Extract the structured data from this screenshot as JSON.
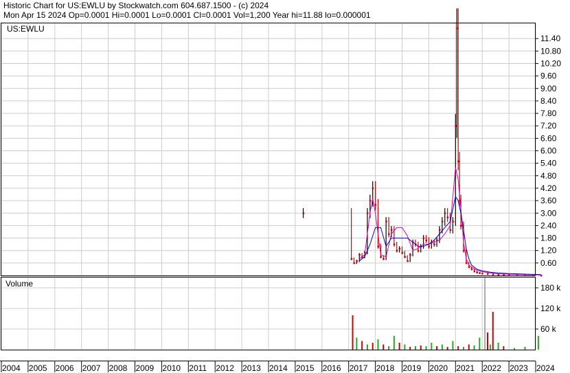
{
  "header": {
    "line1": "Historic Chart for US:EWLU by Stockwatch.com 604.687.1500 - (c) 2024",
    "line2": "Mon Apr 15 2024   Op=0.0001   Hi=0.0001   Lo=0.0001   Cl=0.0001   Vol=1,200   Year hi=11.88   lo=0.000001"
  },
  "colors": {
    "price": "#000000",
    "down": "#cc0000",
    "ma_short": "#dd00aa",
    "ma_long": "#0000cc",
    "vol_up": "#22aa22",
    "vol_down": "#cc0000",
    "vol_big": "#aaaaaa",
    "grid": "#cccccc"
  },
  "chart_data": [
    {
      "type": "line",
      "title": "US:EWLU",
      "x_labels": [
        "2004",
        "2005",
        "2006",
        "2007",
        "2008",
        "2009",
        "2010",
        "2011",
        "2012",
        "2013",
        "2014",
        "2015",
        "2016",
        "2017",
        "2018",
        "2019",
        "2020",
        "2021",
        "2022",
        "2023",
        "2024"
      ],
      "ylim": [
        0,
        12.0
      ],
      "y_ticks": [
        "0.60",
        "1.20",
        "1.80",
        "2.40",
        "3.00",
        "3.60",
        "4.20",
        "4.80",
        "5.40",
        "6.00",
        "6.60",
        "7.20",
        "7.80",
        "8.40",
        "9.00",
        "9.60",
        "10.20",
        "10.80",
        "11.40"
      ],
      "grid": true,
      "series": [
        {
          "role": "price",
          "x": [
            2015.3,
            2017.1,
            2017.2,
            2017.3,
            2017.4,
            2017.5,
            2017.6,
            2017.7,
            2017.8,
            2017.9,
            2018.0,
            2018.1,
            2018.2,
            2018.3,
            2018.4,
            2018.5,
            2018.6,
            2018.7,
            2018.8,
            2018.9,
            2019.0,
            2019.1,
            2019.2,
            2019.3,
            2019.4,
            2019.5,
            2019.6,
            2019.7,
            2019.8,
            2019.9,
            2020.0,
            2020.1,
            2020.2,
            2020.3,
            2020.4,
            2020.5,
            2020.6,
            2020.7,
            2020.8,
            2020.9,
            2021.0,
            2021.05,
            2021.1,
            2021.15,
            2021.2,
            2021.3,
            2021.4,
            2021.5,
            2021.6,
            2021.7,
            2021.8,
            2021.9,
            2022.0,
            2022.2,
            2022.4,
            2022.6,
            2022.8,
            2023.0,
            2023.3,
            2023.6,
            2023.9,
            2024.2
          ],
          "values": [
            3.0,
            0.8,
            0.6,
            0.7,
            1.0,
            0.9,
            1.1,
            3.0,
            3.6,
            4.2,
            3.4,
            1.4,
            0.9,
            0.8,
            2.6,
            2.0,
            2.2,
            1.5,
            1.2,
            1.3,
            1.1,
            0.9,
            0.7,
            1.0,
            1.6,
            1.5,
            1.2,
            1.4,
            1.8,
            1.7,
            1.4,
            1.6,
            1.5,
            1.7,
            2.2,
            2.6,
            3.0,
            2.8,
            2.2,
            2.6,
            7.2,
            11.9,
            5.5,
            3.6,
            2.4,
            1.2,
            0.6,
            0.4,
            0.3,
            0.2,
            0.15,
            0.12,
            0.1,
            0.08,
            0.06,
            0.05,
            0.04,
            0.03,
            0.02,
            0.01,
            0.005,
            0.0001
          ]
        },
        {
          "role": "ma_short",
          "x": [
            2017.4,
            2017.6,
            2017.7,
            2017.8,
            2017.9,
            2018.0,
            2018.2,
            2018.4,
            2018.6,
            2018.8,
            2019.0,
            2019.2,
            2019.4,
            2019.6,
            2019.8,
            2020.0,
            2020.2,
            2020.4,
            2020.6,
            2020.8,
            2021.0,
            2021.1,
            2021.2,
            2021.3,
            2021.4,
            2021.5,
            2021.6,
            2021.8,
            2022.0,
            2022.3,
            2022.6,
            2023.0,
            2023.5,
            2024.0,
            2024.2
          ],
          "values": [
            0.8,
            1.0,
            2.0,
            3.0,
            3.7,
            3.0,
            1.0,
            0.9,
            2.0,
            2.3,
            2.3,
            1.9,
            1.2,
            1.3,
            1.5,
            1.5,
            1.6,
            1.7,
            2.0,
            2.4,
            5.2,
            4.6,
            3.2,
            1.6,
            0.8,
            0.5,
            0.4,
            0.25,
            0.18,
            0.12,
            0.08,
            0.06,
            0.04,
            0.03,
            0.02
          ]
        },
        {
          "role": "ma_long",
          "x": [
            2017.4,
            2017.6,
            2017.8,
            2018.0,
            2018.2,
            2018.4,
            2018.6,
            2018.8,
            2019.0,
            2019.2,
            2019.4,
            2019.6,
            2019.8,
            2020.0,
            2020.2,
            2020.4,
            2020.6,
            2020.8,
            2021.0,
            2021.1,
            2021.2,
            2021.3,
            2021.4,
            2021.5,
            2021.6,
            2021.8,
            2022.0,
            2022.3,
            2022.6,
            2023.0,
            2023.5,
            2024.0,
            2024.2
          ],
          "values": [
            0.7,
            0.9,
            1.5,
            2.3,
            2.3,
            1.4,
            1.8,
            1.8,
            1.8,
            1.8,
            1.6,
            1.4,
            1.4,
            1.5,
            1.7,
            2.0,
            2.3,
            2.6,
            3.8,
            3.6,
            3.0,
            2.2,
            1.3,
            0.8,
            0.5,
            0.3,
            0.22,
            0.16,
            0.12,
            0.09,
            0.07,
            0.05,
            0.04
          ]
        }
      ]
    },
    {
      "type": "bar",
      "title": "Volume",
      "ylim": [
        0,
        210
      ],
      "y_ticks": [
        "60 k",
        "120 k",
        "180 k"
      ],
      "x": [
        2017.15,
        2017.3,
        2017.5,
        2017.7,
        2017.9,
        2018.1,
        2018.3,
        2018.5,
        2018.7,
        2018.9,
        2019.1,
        2019.3,
        2019.5,
        2019.7,
        2019.9,
        2020.1,
        2020.3,
        2020.5,
        2020.7,
        2020.9,
        2021.1,
        2021.3,
        2021.5,
        2021.7,
        2021.9,
        2022.1,
        2022.2,
        2022.3,
        2022.4,
        2022.6,
        2022.8,
        2023.2,
        2023.6,
        2024.1
      ],
      "values": [
        100,
        35,
        25,
        15,
        20,
        30,
        15,
        10,
        40,
        20,
        15,
        8,
        10,
        12,
        10,
        20,
        10,
        15,
        8,
        25,
        10,
        8,
        15,
        12,
        35,
        210,
        50,
        15,
        110,
        20,
        10,
        5,
        8,
        40
      ],
      "down": [
        1,
        0,
        1,
        0,
        1,
        0,
        1,
        0,
        0,
        1,
        0,
        1,
        0,
        1,
        0,
        0,
        1,
        0,
        1,
        0,
        1,
        0,
        1,
        0,
        0,
        0,
        1,
        0,
        1,
        0,
        1,
        0,
        0,
        0
      ]
    }
  ]
}
